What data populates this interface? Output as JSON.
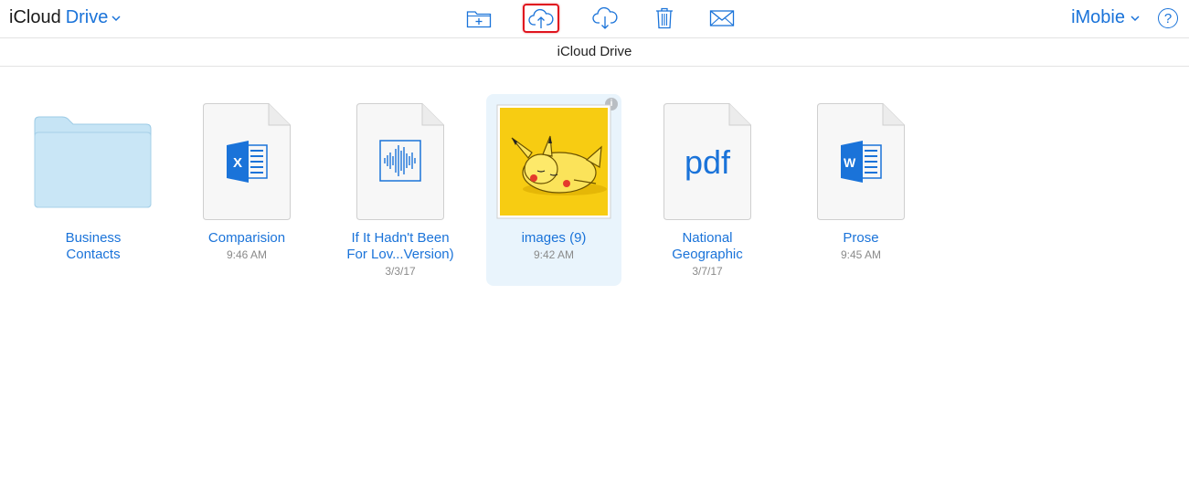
{
  "header": {
    "app_name": "iCloud",
    "service_name": "Drive",
    "user_name": "iMobie",
    "help_label": "?"
  },
  "toolbar": {
    "buttons": [
      {
        "name": "new-folder",
        "icon": "folder-plus-icon"
      },
      {
        "name": "upload",
        "icon": "cloud-upload-icon",
        "highlighted": true
      },
      {
        "name": "download",
        "icon": "cloud-download-icon"
      },
      {
        "name": "delete",
        "icon": "trash-icon"
      },
      {
        "name": "email",
        "icon": "mail-icon"
      }
    ]
  },
  "location": {
    "title": "iCloud Drive"
  },
  "colors": {
    "accent": "#1a73d9",
    "selected_bg": "#e9f4fc",
    "highlight_border": "#e0141e",
    "folder": "#c6e4f5"
  },
  "files": [
    {
      "name_line1": "Business",
      "name_line2": "Contacts",
      "date": "",
      "kind": "folder",
      "icon": "folder-icon"
    },
    {
      "name_line1": "Comparision",
      "name_line2": "",
      "date": "9:46 AM",
      "kind": "excel",
      "icon": "excel-icon"
    },
    {
      "name_line1": "If It Hadn't Been",
      "name_line2": "For Lov...Version)",
      "date": "3/3/17",
      "kind": "audio",
      "icon": "audio-waveform-icon"
    },
    {
      "name_line1": "images (9)",
      "name_line2": "",
      "date": "9:42 AM",
      "kind": "image",
      "icon": "image-thumbnail",
      "selected": true
    },
    {
      "name_line1": "National",
      "name_line2": "Geographic",
      "date": "3/7/17",
      "kind": "pdf",
      "icon": "pdf-icon",
      "icon_text": "pdf"
    },
    {
      "name_line1": "Prose",
      "name_line2": "",
      "date": "9:45 AM",
      "kind": "word",
      "icon": "word-icon"
    }
  ]
}
